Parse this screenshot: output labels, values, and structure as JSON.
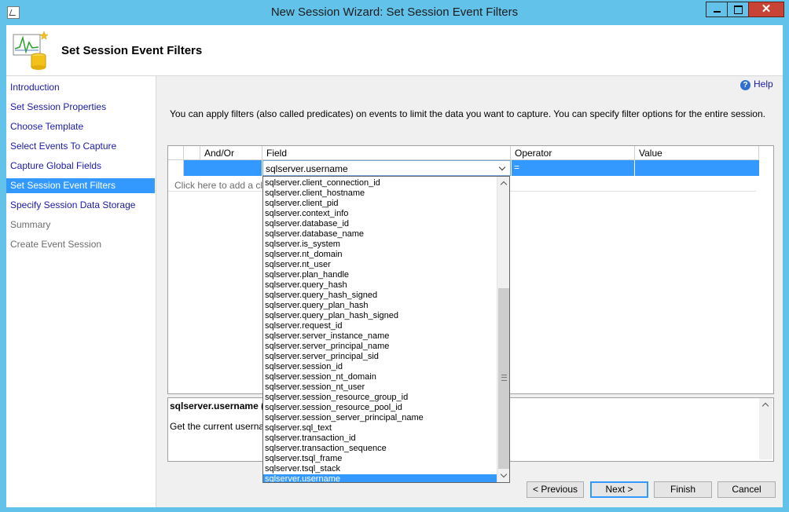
{
  "window": {
    "title": "New Session Wizard: Set Session Event Filters",
    "close_glyph": "✕"
  },
  "header": {
    "title": "Set Session Event Filters",
    "icon": "session-chart-database-icon"
  },
  "sidebar": {
    "items": [
      {
        "label": "Introduction",
        "state": "link"
      },
      {
        "label": "Set Session Properties",
        "state": "link"
      },
      {
        "label": "Choose Template",
        "state": "link"
      },
      {
        "label": "Select Events To Capture",
        "state": "link"
      },
      {
        "label": "Capture Global Fields",
        "state": "link"
      },
      {
        "label": "Set Session Event Filters",
        "state": "active"
      },
      {
        "label": "Specify Session Data Storage",
        "state": "link"
      },
      {
        "label": "Summary",
        "state": "disabled"
      },
      {
        "label": "Create Event Session",
        "state": "disabled"
      }
    ]
  },
  "help": {
    "label": "Help",
    "glyph": "?"
  },
  "intro_text": "You can apply filters (also called predicates) on events to limit the data you want to capture. You can specify filter options for the entire session.",
  "grid": {
    "columns": [
      "",
      "",
      "And/Or",
      "Field",
      "Operator",
      "Value"
    ],
    "row": {
      "field": "sqlserver.username",
      "operator": "="
    },
    "add_clause_text": "Click here to add a clau"
  },
  "dropdown": {
    "items": [
      "sqlserver.client_connection_id",
      "sqlserver.client_hostname",
      "sqlserver.client_pid",
      "sqlserver.context_info",
      "sqlserver.database_id",
      "sqlserver.database_name",
      "sqlserver.is_system",
      "sqlserver.nt_domain",
      "sqlserver.nt_user",
      "sqlserver.plan_handle",
      "sqlserver.query_hash",
      "sqlserver.query_hash_signed",
      "sqlserver.query_plan_hash",
      "sqlserver.query_plan_hash_signed",
      "sqlserver.request_id",
      "sqlserver.server_instance_name",
      "sqlserver.server_principal_name",
      "sqlserver.server_principal_sid",
      "sqlserver.session_id",
      "sqlserver.session_nt_domain",
      "sqlserver.session_nt_user",
      "sqlserver.session_resource_group_id",
      "sqlserver.session_resource_pool_id",
      "sqlserver.session_server_principal_name",
      "sqlserver.sql_text",
      "sqlserver.transaction_id",
      "sqlserver.transaction_sequence",
      "sqlserver.tsql_frame",
      "sqlserver.tsql_stack",
      "sqlserver.username"
    ],
    "selected": "sqlserver.username"
  },
  "description": {
    "title": "sqlserver.username (",
    "text": "Get the current userna"
  },
  "buttons": {
    "previous": "< Previous",
    "next": "Next >",
    "finish": "Finish",
    "cancel": "Cancel"
  },
  "colors": {
    "titlebar": "#63c2ea",
    "selection": "#3399ff",
    "link": "#1a1aa6",
    "close": "#c74335"
  }
}
